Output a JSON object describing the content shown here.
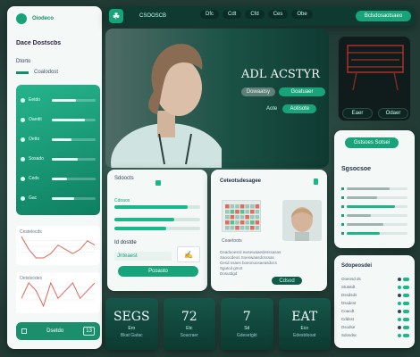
{
  "sidebar": {
    "brand": "Oiodeco",
    "title": "Dace Dostscbs",
    "subtitle": "Dtorto",
    "tag": "Coalodost",
    "nav": [
      {
        "label": "Eetdo",
        "level": 0.55
      },
      {
        "label": "Oaedit",
        "level": 0.75
      },
      {
        "label": "Oetto",
        "level": 0.45
      },
      {
        "label": "Sosado",
        "level": 0.6
      },
      {
        "label": "Ceds",
        "level": 0.35
      },
      {
        "label": "Gac",
        "level": 0.5
      }
    ],
    "footer_label": "Dsetdo",
    "footer_num": "13",
    "footer_icon": "grid-icon"
  },
  "topbar": {
    "logo_icon": "leaf-logo-icon",
    "app": "CSOOSCB",
    "nav": [
      "Dfc",
      "Cdt",
      "Cfd",
      "Ces",
      "Obe"
    ],
    "cta": "Bclsdosaotsaeo"
  },
  "hero": {
    "title": "ADL ACSTYR",
    "btn1": "Dowaatsy",
    "btn2": "Goatuaer",
    "link": "Aote",
    "btn3": "Aotisote"
  },
  "promo": {
    "btn1": "Eaer",
    "btn2": "Odaer"
  },
  "form": {
    "header": "Sdoocts",
    "progress": [
      0.85,
      0.7,
      0.6
    ],
    "field": "Cdoaos",
    "section": "Id dostde",
    "input": "Jnteaest",
    "submit": "Pcoasto"
  },
  "charts": {
    "a": {
      "label": "Cestelocds",
      "values": [
        7,
        4,
        2,
        2,
        3,
        5,
        4,
        3,
        4,
        6,
        5
      ]
    },
    "b": {
      "label": "Oetslsodes",
      "values": [
        4,
        6,
        5,
        3,
        6,
        4,
        5,
        6,
        4,
        5,
        6
      ]
    }
  },
  "article": {
    "title": "Ceteotsdesagee",
    "caption": "Ceaetoots",
    "action": "Cdsod",
    "para_lines": [
      "Ceaduoesrd ewsewaaedesssasas",
      "Saoocdeos Soeswaasdcsssas",
      "Cesd osaes boeonuosaeasdocs",
      "Sgutcd gmot",
      "Dosutdgd"
    ]
  },
  "right_panel": {
    "chip": "Gstsoes Sotsei",
    "title": "Sgsocsoe",
    "rows": [
      0.7,
      0.5,
      0.8,
      0.4,
      0.6,
      0.55
    ]
  },
  "list_panel": {
    "title": "Sdopeosdei",
    "items": [
      "Ooeosd ds",
      "Stutstdt",
      "Dssdsds",
      "Dssdest",
      "Coacdt",
      "Cddsst",
      "Dsodse",
      "Sdosdsc"
    ]
  },
  "stats": [
    {
      "value": "SEGS",
      "label": "Ero",
      "sub": "Bkat Gatac"
    },
    {
      "value": "72",
      "label": "Etc",
      "sub": "Soacraer"
    },
    {
      "value": "7",
      "label": "Sd",
      "sub": "Gdesetgkt"
    },
    {
      "value": "EAT",
      "label": "Eco",
      "sub": "Edestdooat"
    }
  ],
  "colors": {
    "accent": "#18b888",
    "dark": "#0f3a32",
    "light": "#f4f8f7"
  }
}
